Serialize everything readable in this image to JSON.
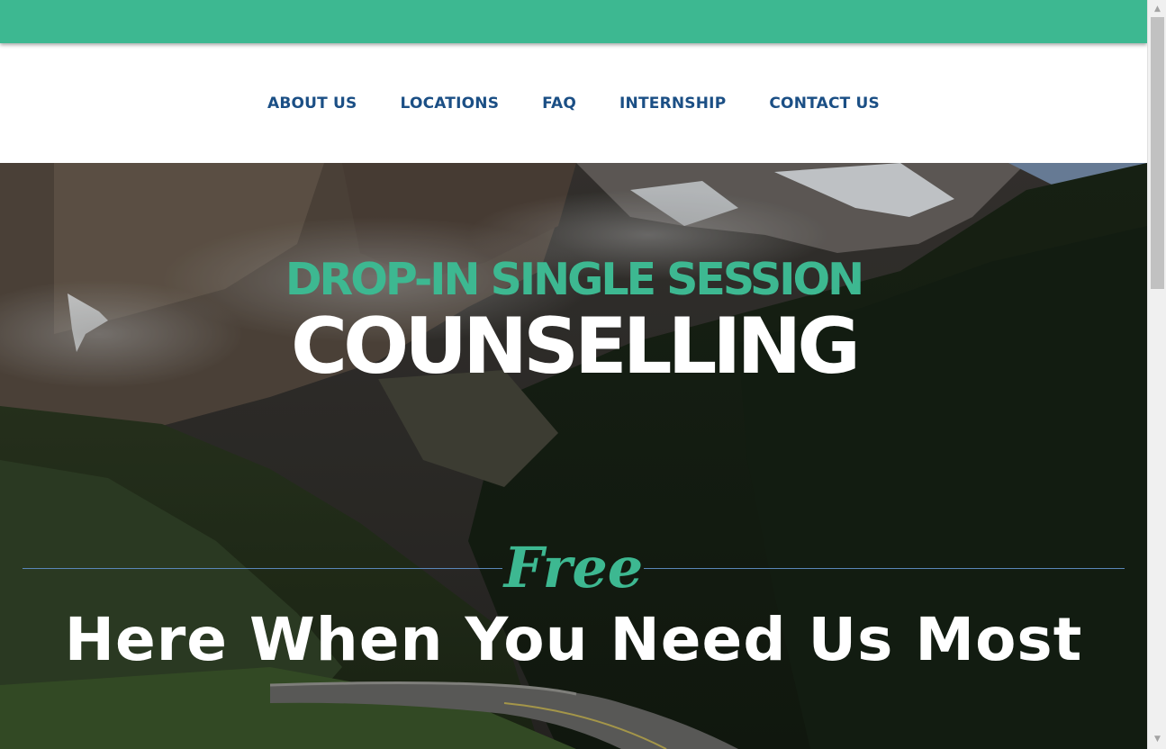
{
  "colors": {
    "brand_green": "#3db891",
    "nav_blue": "#1b4f85",
    "divider_blue": "#5a86b8"
  },
  "nav": {
    "items": [
      {
        "label": "ABOUT US"
      },
      {
        "label": "LOCATIONS"
      },
      {
        "label": "FAQ"
      },
      {
        "label": "INTERNSHIP"
      },
      {
        "label": "CONTACT US"
      }
    ]
  },
  "hero": {
    "background": "mountain-road-landscape",
    "title_line1": "DROP-IN SINGLE SESSION",
    "title_line2": "COUNSELLING",
    "free_label": "Free",
    "tagline": "Here When You Need Us Most"
  },
  "scrollbar": {
    "up_icon": "triangle-up-icon",
    "down_icon": "triangle-down-icon"
  }
}
